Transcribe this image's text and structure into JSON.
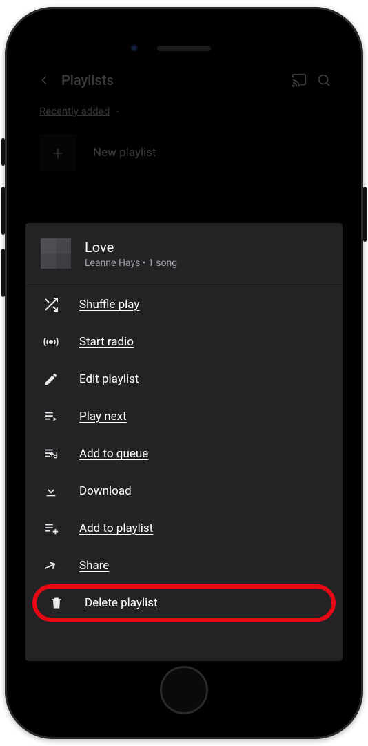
{
  "header": {
    "title": "Playlists",
    "sort_label": "Recently added"
  },
  "new_playlist": {
    "label": "New playlist"
  },
  "sheet": {
    "title": "Love",
    "subtitle": "Leanne Hays • 1 song",
    "items": [
      {
        "label": "Shuffle play"
      },
      {
        "label": "Start radio"
      },
      {
        "label": "Edit playlist"
      },
      {
        "label": "Play next"
      },
      {
        "label": "Add to queue"
      },
      {
        "label": "Download"
      },
      {
        "label": "Add to playlist"
      },
      {
        "label": "Share"
      },
      {
        "label": "Delete playlist"
      }
    ]
  },
  "colors": {
    "sheet_bg": "#232326",
    "highlight": "#e50914"
  }
}
